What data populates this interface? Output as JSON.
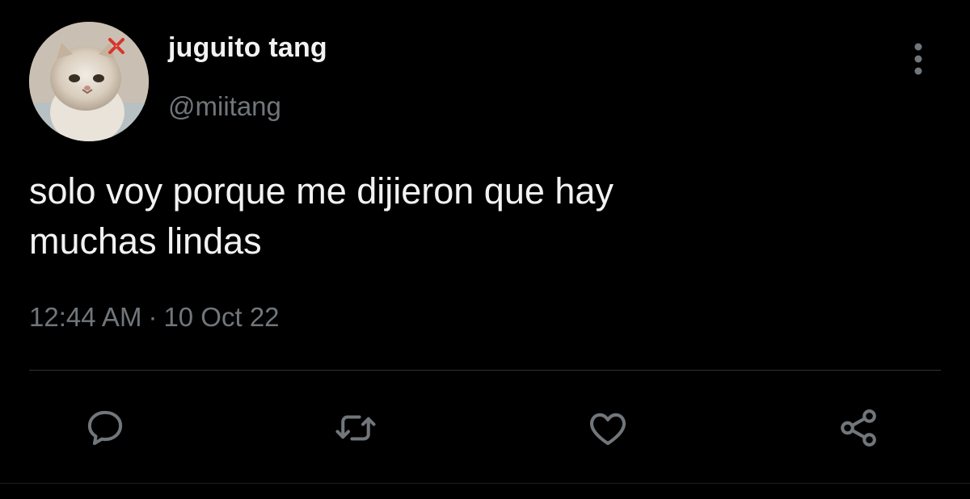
{
  "user": {
    "display_name": "juguito tang",
    "handle": "@miitang",
    "avatar": "avatar-cat-icon"
  },
  "tweet": {
    "text_line1": "solo voy porque me dijieron que hay",
    "text_line2": "muchas lindas",
    "time": "12:44 AM",
    "separator": "·",
    "date": "10 Oct 22"
  },
  "actions": {
    "reply": "reply-icon",
    "retweet": "retweet-icon",
    "like": "heart-icon",
    "share": "share-icon"
  },
  "colors": {
    "background": "#000000",
    "primary_text": "#f2f2f2",
    "secondary_text": "#71767b",
    "divider": "#2f3336",
    "icon": "#71767b"
  }
}
